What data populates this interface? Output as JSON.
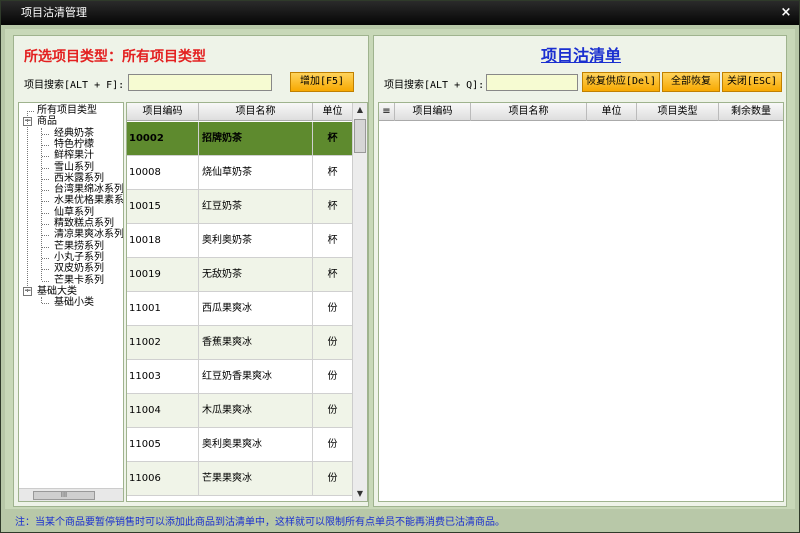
{
  "window": {
    "title": "项目沽清管理",
    "close_label": "×"
  },
  "left": {
    "title": "所选项目类型：所有项目类型",
    "search_label": "项目搜索[ALT + F]:",
    "search_value": "",
    "add_button": "增加[F5]",
    "tree": {
      "root": "所有项目类型",
      "goods": "商品",
      "goods_children": [
        "经典奶茶",
        "特色柠檬",
        "鲜榨果汁",
        "雪山系列",
        "西米露系列",
        "台湾果绵冰系列",
        "水果优格果素系列",
        "仙草系列",
        "精致糕点系列",
        "清凉果爽冰系列",
        "芒果捞系列",
        "小丸子系列",
        "双皮奶系列",
        "芒果卡系列"
      ],
      "base": "基础大类",
      "base_children": [
        "基础小类"
      ],
      "scroll_thumb": "III"
    },
    "grid": {
      "headers": [
        "项目编码",
        "项目名称",
        "单位"
      ],
      "rows": [
        {
          "code": "10002",
          "name": "招牌奶茶",
          "unit": "杯"
        },
        {
          "code": "10008",
          "name": "烧仙草奶茶",
          "unit": "杯"
        },
        {
          "code": "10015",
          "name": "红豆奶茶",
          "unit": "杯"
        },
        {
          "code": "10018",
          "name": "奥利奥奶茶",
          "unit": "杯"
        },
        {
          "code": "10019",
          "name": "无敌奶茶",
          "unit": "杯"
        },
        {
          "code": "11001",
          "name": "西瓜果爽冰",
          "unit": "份"
        },
        {
          "code": "11002",
          "name": "香蕉果爽冰",
          "unit": "份"
        },
        {
          "code": "11003",
          "name": "红豆奶香果爽冰",
          "unit": "份"
        },
        {
          "code": "11004",
          "name": "木瓜果爽冰",
          "unit": "份"
        },
        {
          "code": "11005",
          "name": "奥利奥果爽冰",
          "unit": "份"
        },
        {
          "code": "11006",
          "name": "芒果果爽冰",
          "unit": "份"
        }
      ],
      "scroll_up": "▲",
      "scroll_down": "▼"
    }
  },
  "right": {
    "title": "项目沽清单",
    "search_label": "项目搜索[ALT + Q]:",
    "search_value": "",
    "restore_button": "恢复供应[Del]",
    "restore_all_button": "全部恢复",
    "close_button": "关闭[ESC]",
    "grid": {
      "menu_glyph": "≡",
      "headers": [
        "项目编码",
        "项目名称",
        "单位",
        "项目类型",
        "剩余数量"
      ]
    }
  },
  "note": "注：当某个商品要暂停销售时可以添加此商品到沽清单中，这样就可以限制所有点单员不能再消费已沽清商品。"
}
